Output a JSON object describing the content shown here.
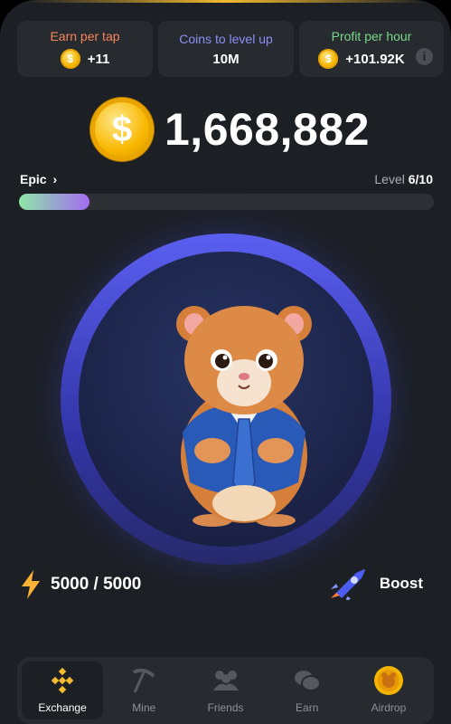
{
  "stats": {
    "earn_per_tap": {
      "label": "Earn per tap",
      "value": "+11",
      "color": "#f5855a"
    },
    "coins_to_level": {
      "label": "Coins to level up",
      "value": "10M",
      "color": "#8a8ff5"
    },
    "profit_per_hour": {
      "label": "Profit per hour",
      "value": "+101.92K",
      "color": "#78d98a"
    }
  },
  "coin_symbol": "$",
  "info_symbol": "i",
  "balance": "1,668,882",
  "level": {
    "name": "Epic",
    "chevron": "›",
    "prefix": "Level",
    "value": "6/10",
    "progress_fraction": 0.17
  },
  "energy": {
    "value": "5000 / 5000",
    "icon": "lightning-icon"
  },
  "boost": {
    "label": "Boost",
    "icon": "rocket-icon"
  },
  "nav": {
    "items": [
      {
        "label": "Exchange",
        "icon": "binance-icon",
        "active": true
      },
      {
        "label": "Mine",
        "icon": "pickaxe-icon"
      },
      {
        "label": "Friends",
        "icon": "friends-icon"
      },
      {
        "label": "Earn",
        "icon": "coins-icon"
      },
      {
        "label": "Airdrop",
        "icon": "hamster-coin-icon"
      }
    ]
  },
  "colors": {
    "accent": "#f3ba2f",
    "background": "#1c1f24",
    "card": "#272a2f",
    "circle": "#4f55e0"
  }
}
